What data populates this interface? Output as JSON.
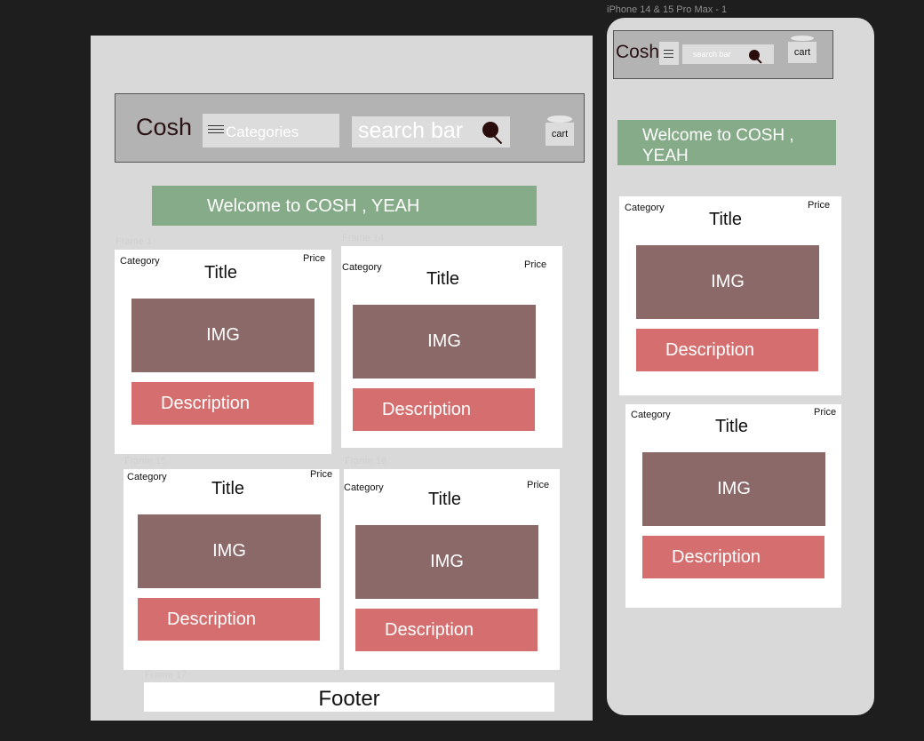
{
  "frames": {
    "iphone": "iPhone 14 & 15 Pro Max - 1",
    "frame1": "Frame 1",
    "frame14": "Frame 14",
    "frame15": "Frame 15",
    "frame16": "Frame 16",
    "frame17": "Frame 17"
  },
  "desktop": {
    "logo": "Cosh",
    "categories": "Categories",
    "search": "search bar",
    "cart": "cart",
    "welcome": "Welcome to COSH , YEAH",
    "footer": "Footer",
    "cards": [
      {
        "category": "Category",
        "title": "Title",
        "price": "Price",
        "img": "IMG",
        "description": "Description"
      },
      {
        "category": "Category",
        "title": "Title",
        "price": "Price",
        "img": "IMG",
        "description": "Description"
      },
      {
        "category": "Category",
        "title": "Title",
        "price": "Price",
        "img": "IMG",
        "description": "Description"
      },
      {
        "category": "Category",
        "title": "Title",
        "price": "Price",
        "img": "IMG",
        "description": "Description"
      }
    ]
  },
  "mobile": {
    "logo": "Cosh",
    "search": "search bar",
    "cart": "cart",
    "welcome_line1": "Welcome to COSH ,",
    "welcome_line2": "YEAH",
    "cards": [
      {
        "category": "Category",
        "title": "Title",
        "price": "Price",
        "img": "IMG",
        "description": "Description"
      },
      {
        "category": "Category",
        "title": "Title",
        "price": "Price",
        "img": "IMG",
        "description": "Description"
      }
    ]
  },
  "colors": {
    "canvas": "#1e1e1e",
    "frame": "#d9d9d9",
    "header": "#b3b3b3",
    "welcome": "#86ab88",
    "img": "#8b6969",
    "description": "#d56f6f"
  }
}
